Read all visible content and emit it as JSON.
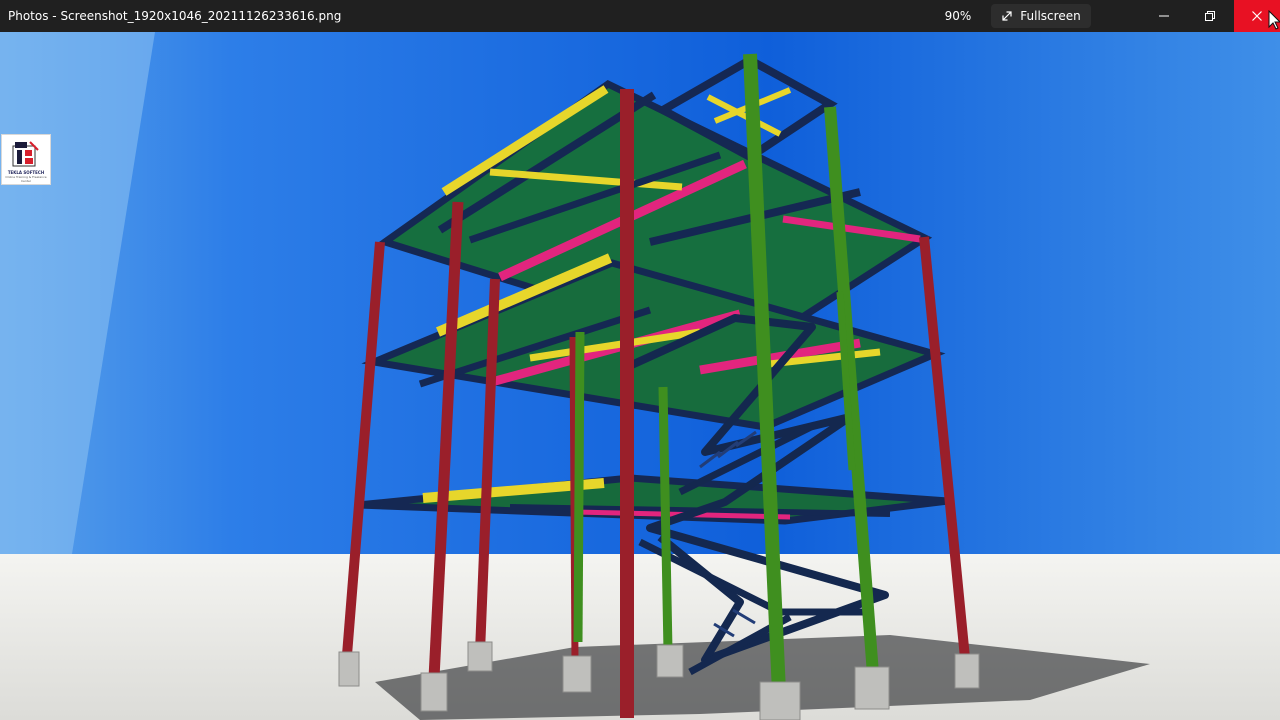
{
  "window": {
    "title": "Photos - Screenshot_1920x1046_20211126233616.png",
    "zoom_level": "90%",
    "fullscreen_label": "Fullscreen"
  },
  "icons": {
    "fullscreen": "diagonal-expand-arrow-icon",
    "minimize": "minimize-icon",
    "restore": "restore-icon",
    "close": "close-icon",
    "cursor": "mouse-pointer-icon"
  },
  "colors": {
    "titlebar": "#202020",
    "close_hover": "#e81123",
    "sky": "#1f6fe5",
    "ground": "#eeeeea",
    "red_member": "#9a1f2a",
    "green_member": "#3f8f1f",
    "navy_member": "#152853",
    "yellow_member": "#e7d62b",
    "magenta_member": "#e2257e",
    "deck_green": "#166f3f"
  },
  "logo": {
    "brand_text": "TEKLA SOFTECH",
    "sub_text": "Online Training & Freelance Center"
  }
}
